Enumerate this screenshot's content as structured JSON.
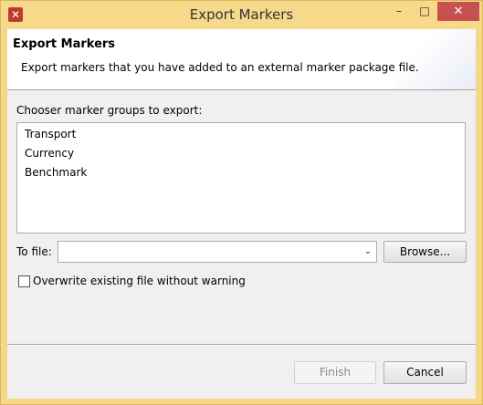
{
  "window": {
    "title": "Export Markers",
    "app_icon": "eclipse-x-icon",
    "controls": {
      "minimize": "–",
      "maximize": "□",
      "close": "✕"
    }
  },
  "banner": {
    "title": "Export Markers",
    "description": "Export markers that you have added to an external marker package file."
  },
  "groups": {
    "label": "Chooser marker groups to export:",
    "items": [
      "Transport",
      "Currency",
      "Benchmark"
    ]
  },
  "file": {
    "label": "To file:",
    "value": "",
    "dropdown_glyph": "⌄",
    "browse_label": "Browse..."
  },
  "overwrite": {
    "label": "Overwrite existing file without warning",
    "checked": false
  },
  "footer": {
    "finish_label": "Finish",
    "finish_enabled": false,
    "cancel_label": "Cancel"
  },
  "colors": {
    "titlebar": "#f6d98a",
    "close_button": "#c75050",
    "dialog_bg": "#f0f0f0"
  }
}
